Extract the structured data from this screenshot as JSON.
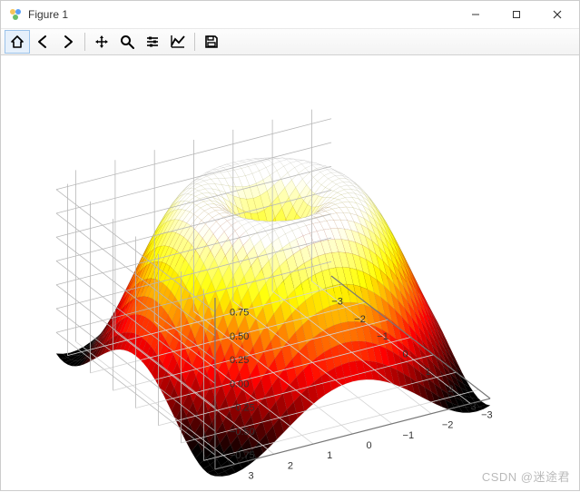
{
  "window": {
    "title": "Figure 1",
    "controls": {
      "minimize": "—",
      "maximize": "☐",
      "close": "✕"
    }
  },
  "toolbar": {
    "items": [
      {
        "name": "home-icon",
        "active": true
      },
      {
        "name": "back-icon",
        "active": false
      },
      {
        "name": "forward-icon",
        "active": false
      },
      {
        "sep": true
      },
      {
        "name": "pan-icon",
        "active": false
      },
      {
        "name": "zoom-icon",
        "active": false
      },
      {
        "name": "subplots-icon",
        "active": false
      },
      {
        "name": "axes-icon",
        "active": false
      },
      {
        "sep": true
      },
      {
        "name": "save-icon",
        "active": false
      }
    ]
  },
  "watermark": "CSDN @迷途君",
  "chart_data": {
    "type": "surface3d",
    "colormap": "hot",
    "x": {
      "range": [
        -3.5,
        3.5
      ],
      "ticks": [
        -3,
        -2,
        -1,
        0,
        1,
        2,
        3
      ]
    },
    "y": {
      "range": [
        -3.5,
        3.5
      ],
      "ticks": [
        -3,
        -2,
        -1,
        0,
        1,
        2,
        3
      ]
    },
    "z": {
      "range": [
        -0.9,
        0.9
      ],
      "ticks": [
        -0.75,
        -0.5,
        -0.25,
        0.0,
        0.25,
        0.5,
        0.75
      ]
    },
    "function": "sin(sqrt(x^2 + y^2))",
    "grid_resolution": 40,
    "elev_deg": 30,
    "azim_deg": -60
  }
}
